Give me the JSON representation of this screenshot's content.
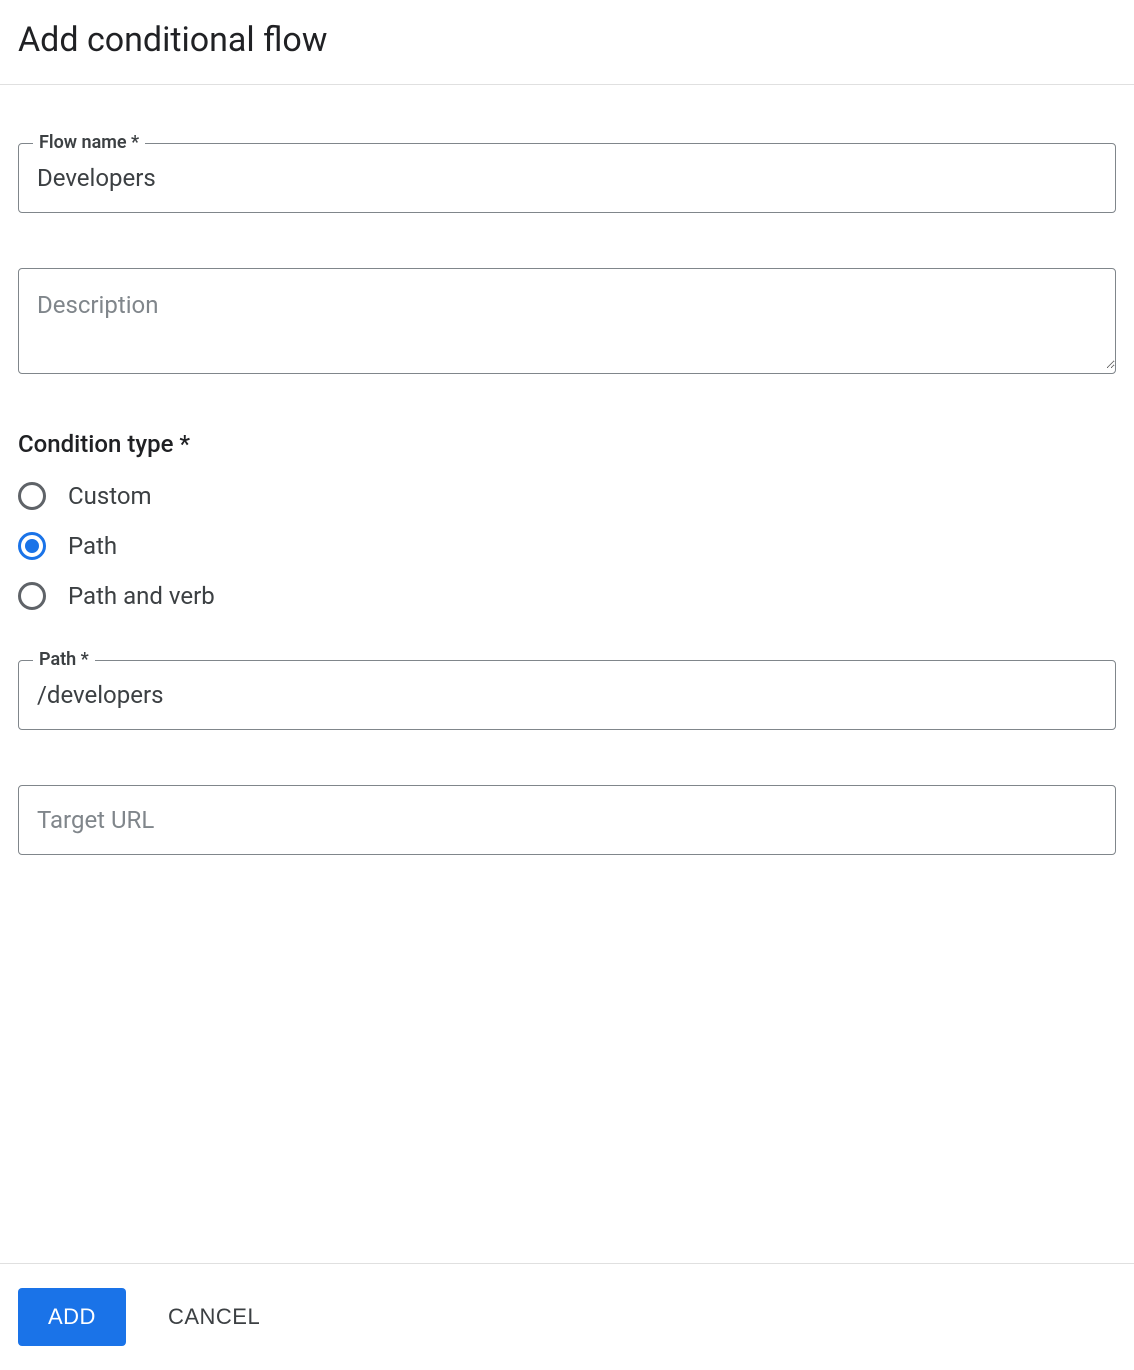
{
  "header": {
    "title": "Add conditional flow"
  },
  "form": {
    "flow_name": {
      "label": "Flow name *",
      "value": "Developers"
    },
    "description": {
      "placeholder": "Description",
      "value": ""
    },
    "condition_type": {
      "label": "Condition type *",
      "options": [
        {
          "id": "custom",
          "label": "Custom",
          "selected": false
        },
        {
          "id": "path",
          "label": "Path",
          "selected": true
        },
        {
          "id": "path_and_verb",
          "label": "Path and verb",
          "selected": false
        }
      ]
    },
    "path": {
      "label": "Path *",
      "value": "/developers"
    },
    "target_url": {
      "placeholder": "Target URL",
      "value": ""
    }
  },
  "footer": {
    "add_label": "ADD",
    "cancel_label": "CANCEL"
  }
}
